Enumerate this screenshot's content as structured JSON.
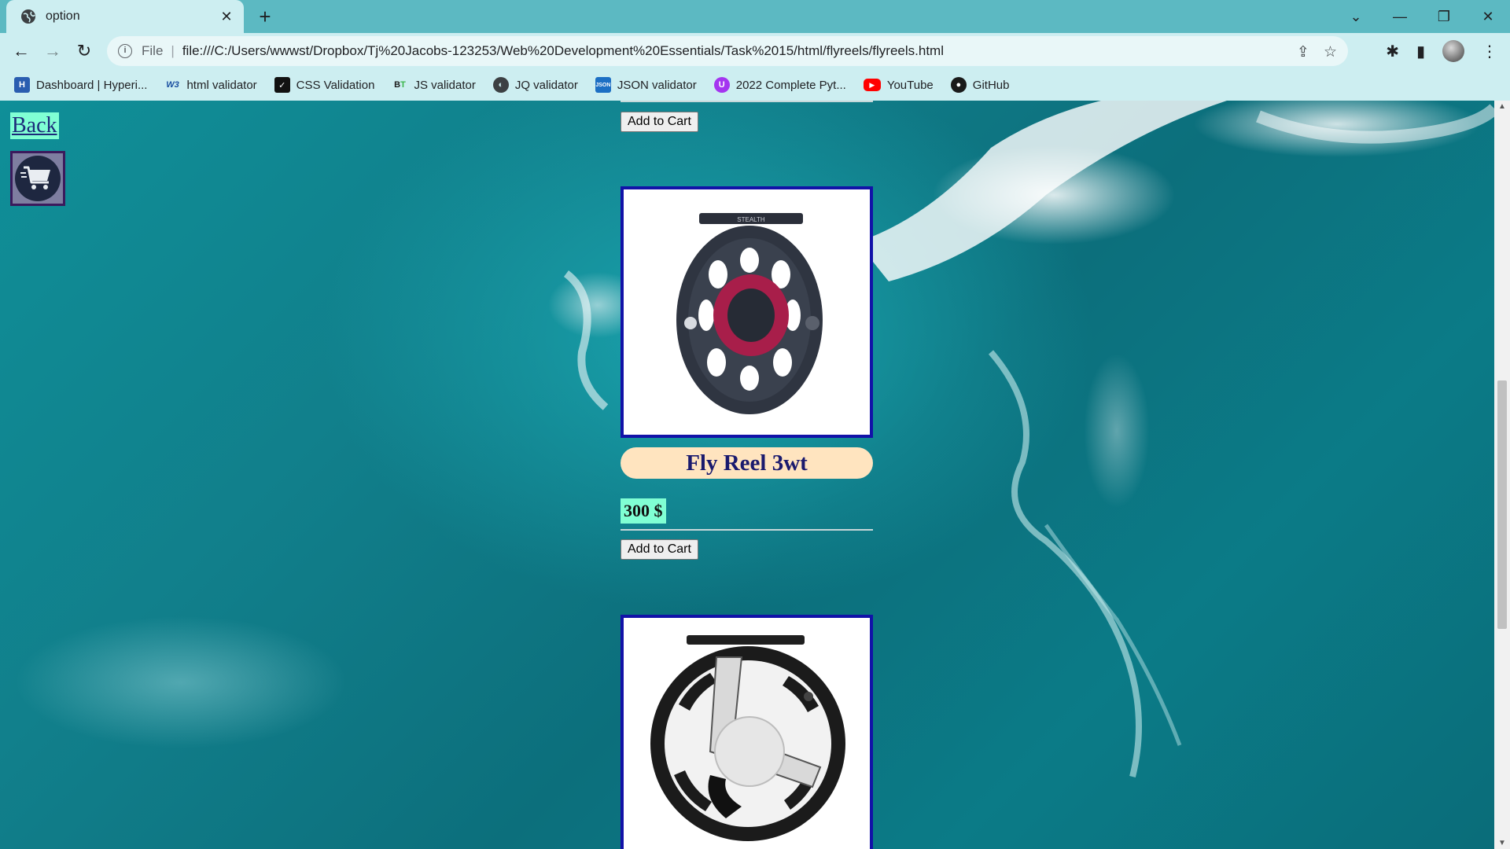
{
  "browser": {
    "tab_title": "option",
    "new_tab_symbol": "+",
    "close_symbol": "✕",
    "scheme_label": "File",
    "url": "file:///C:/Users/wwwst/Dropbox/Tj%20Jacobs-123253/Web%20Development%20Essentials/Task%2015/html/flyreels/flyreels.html",
    "bookmarks": [
      {
        "label": "Dashboard | Hyperi...",
        "icon": "hyperiondev-icon"
      },
      {
        "label": "html validator",
        "icon": "w3c-icon"
      },
      {
        "label": "CSS Validation",
        "icon": "css-validator-icon"
      },
      {
        "label": "JS validator",
        "icon": "bt-icon"
      },
      {
        "label": "JQ validator",
        "icon": "globe-icon"
      },
      {
        "label": "JSON validator",
        "icon": "json-icon"
      },
      {
        "label": "2022 Complete Pyt...",
        "icon": "udemy-icon"
      },
      {
        "label": "YouTube",
        "icon": "youtube-icon"
      },
      {
        "label": "GitHub",
        "icon": "github-icon"
      }
    ]
  },
  "page": {
    "back_label": "Back",
    "add_to_cart_label": "Add to Cart",
    "products": [
      {
        "name": "Fly Reel 3wt",
        "price": "300 $"
      }
    ]
  },
  "colors": {
    "accent_green": "#80ffd4",
    "name_pill": "#ffe4bf",
    "card_border": "#1212a8"
  }
}
